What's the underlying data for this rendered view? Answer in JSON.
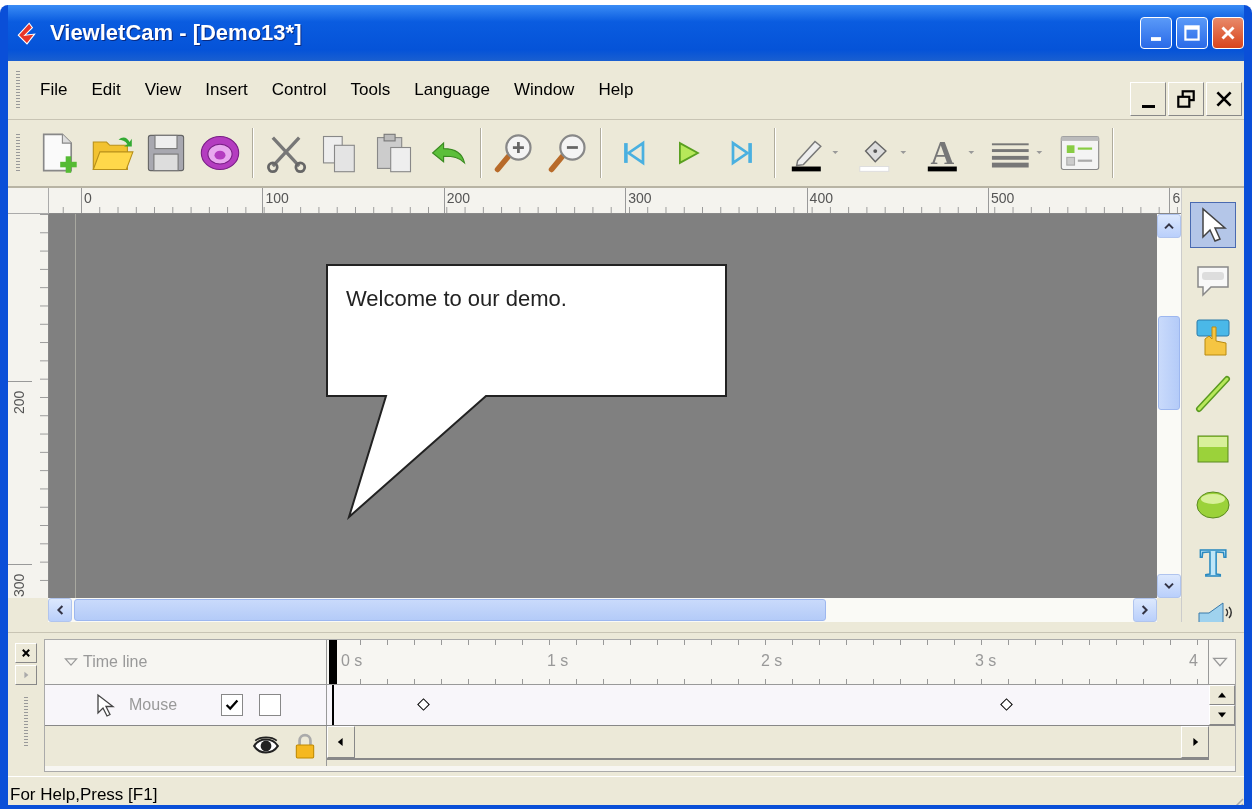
{
  "window": {
    "title": "ViewletCam - [Demo13*]"
  },
  "menu": [
    "File",
    "Edit",
    "View",
    "Insert",
    "Control",
    "Tools",
    "Language",
    "Window",
    "Help"
  ],
  "toolbar": {
    "font_color_glyph": "A"
  },
  "rulers": {
    "horizontal_labels": [
      "0",
      "100",
      "200",
      "300",
      "400",
      "500",
      "6"
    ],
    "vertical_labels": [
      "200",
      "300"
    ]
  },
  "canvas": {
    "callout_text": "Welcome to our demo."
  },
  "tools": [
    {
      "selected": true
    },
    {
      "selected": false
    },
    {
      "selected": false
    },
    {
      "selected": false
    },
    {
      "selected": false
    },
    {
      "selected": false
    },
    {
      "selected": false,
      "glyph": "T"
    },
    {
      "selected": false
    }
  ],
  "timeline": {
    "title": "Time line",
    "expanded": true,
    "time_labels": [
      "0 s",
      "1 s",
      "2 s",
      "3 s",
      "4"
    ],
    "tracks": [
      {
        "name": "Mouse",
        "visible": true,
        "locked": false
      }
    ]
  },
  "status_bar": "For Help,Press [F1]"
}
